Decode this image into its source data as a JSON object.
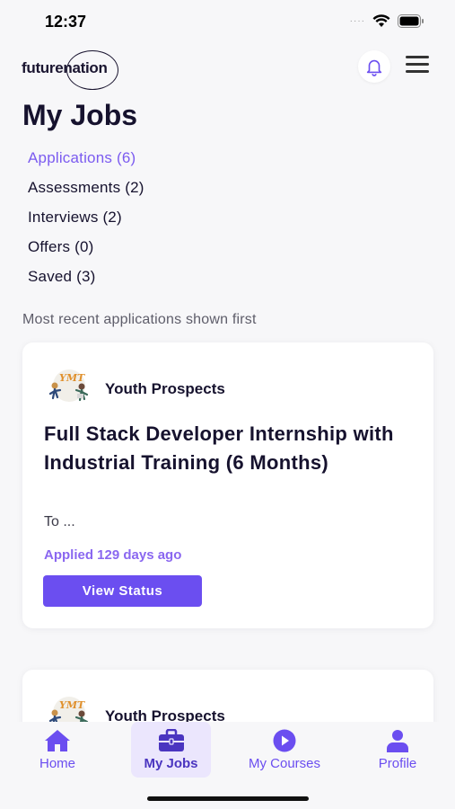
{
  "status_bar": {
    "time": "12:37",
    "signal": "····"
  },
  "header": {
    "logo_text": "futurenation"
  },
  "page": {
    "title": "My Jobs"
  },
  "tabs": [
    {
      "label": "Applications (6)"
    },
    {
      "label": "Assessments (2)"
    },
    {
      "label": "Interviews (2)"
    },
    {
      "label": "Offers (0)"
    },
    {
      "label": "Saved (3)"
    }
  ],
  "list": {
    "subtitle": "Most recent applications shown first"
  },
  "jobs": [
    {
      "company": "Youth Prospects",
      "title": "Full Stack Developer Internship with Industrial Training (6 Months)",
      "description": "To ...",
      "applied": "Applied 129 days ago",
      "button": "View Status"
    },
    {
      "company": "Youth Prospects"
    }
  ],
  "nav": [
    {
      "label": "Home",
      "icon": "home-icon"
    },
    {
      "label": "My Jobs",
      "icon": "briefcase-icon"
    },
    {
      "label": "My Courses",
      "icon": "play-circle-icon"
    },
    {
      "label": "Profile",
      "icon": "person-icon"
    }
  ],
  "colors": {
    "accent": "#6b4ef0",
    "active_tab": "#7b5bf0",
    "text": "#16122e"
  }
}
